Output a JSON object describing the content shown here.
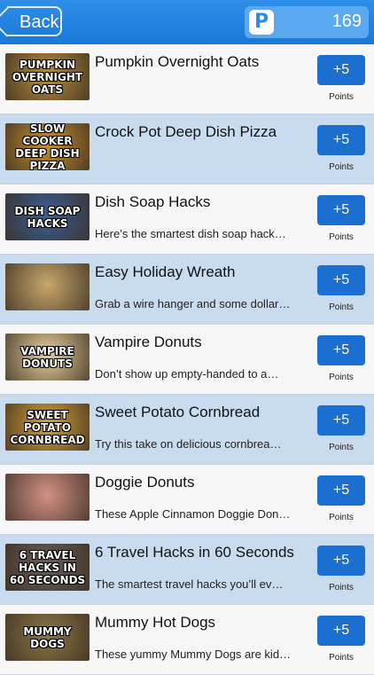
{
  "nav": {
    "back_label": "Back",
    "points_icon": "P",
    "points_total": "169"
  },
  "items": [
    {
      "title": "Pumpkin Overnight Oats",
      "description": "",
      "thumb_text": "PUMPKIN\nOVERNIGHT\nOATS",
      "thumb_color": "#b98c3e",
      "reward": "+5",
      "reward_caption": "Points"
    },
    {
      "title": "Crock Pot Deep Dish Pizza",
      "description": "",
      "thumb_text": "SLOW COOKER\nDEEP DISH\nPIZZA",
      "thumb_color": "#c9912f",
      "reward": "+5",
      "reward_caption": "Points"
    },
    {
      "title": "Dish Soap Hacks",
      "description": "Here’s the smartest dish soap hack…",
      "thumb_text": "DISH SOAP\nHACKS",
      "thumb_color": "#3b5f95",
      "reward": "+5",
      "reward_caption": "Points"
    },
    {
      "title": "Easy Holiday Wreath",
      "description": "Grab a wire hanger and some dollar…",
      "thumb_text": "",
      "thumb_color": "#c7a86b",
      "reward": "+5",
      "reward_caption": "Points"
    },
    {
      "title": "Vampire Donuts",
      "description": "Don’t show up empty-handed to a…",
      "thumb_text": "VAMPIRE\nDONUTS",
      "thumb_color": "#e7cf9a",
      "reward": "+5",
      "reward_caption": "Points"
    },
    {
      "title": "Sweet Potato Cornbread",
      "description": "Try this take on delicious cornbrea…",
      "thumb_text": "SWEET POTATO\nCORNBREAD",
      "thumb_color": "#d9a233",
      "reward": "+5",
      "reward_caption": "Points"
    },
    {
      "title": "Doggie Donuts",
      "description": "These Apple Cinnamon Doggie Don…",
      "thumb_text": "",
      "thumb_color": "#d49185",
      "reward": "+5",
      "reward_caption": "Points"
    },
    {
      "title": "6 Travel Hacks in 60 Seconds",
      "description": "The smartest travel hacks you’ll ev…",
      "thumb_text": "6 TRAVEL\nHACKS IN\n60 SECONDS",
      "thumb_color": "#6b5d56",
      "reward": "+5",
      "reward_caption": "Points"
    },
    {
      "title": "Mummy Hot Dogs",
      "description": "These yummy Mummy Dogs are kid…",
      "thumb_text": "MUMMY DOGS",
      "thumb_color": "#8d7745",
      "reward": "+5",
      "reward_caption": "Points"
    }
  ]
}
